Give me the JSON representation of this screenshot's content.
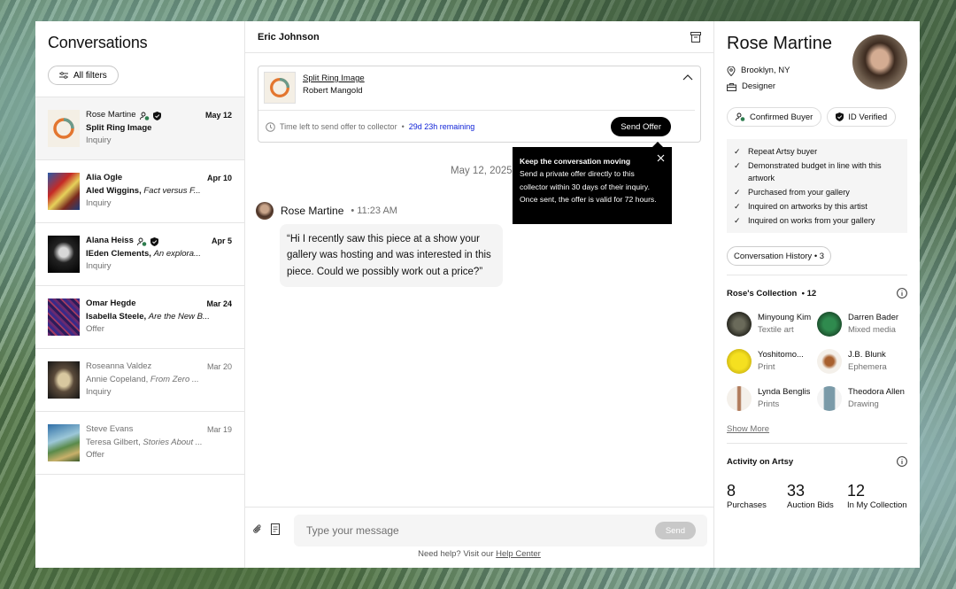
{
  "conversations_panel": {
    "title": "Conversations",
    "filter_label": "All filters",
    "items": [
      {
        "name": "Rose Martine",
        "line2_title": "Split Ring Image",
        "line2_artist": "",
        "type": "Inquiry",
        "date": "May 12"
      },
      {
        "name": "Alia Ogle",
        "line2_artist": "Aled Wiggins,",
        "line2_title": "Fact versus F...",
        "type": "Inquiry",
        "date": "Apr 10"
      },
      {
        "name": "Alana Heiss",
        "line2_artist": "IEden Clements,",
        "line2_title": "An explora...",
        "type": "Inquiry",
        "date": "Apr 5"
      },
      {
        "name": "Omar Hegde",
        "line2_artist": "Isabella Steele,",
        "line2_title": "Are the New B...",
        "type": "Offer",
        "date": "Mar 24"
      },
      {
        "name": "Roseanna Valdez",
        "line2_artist": "Annie Copeland,",
        "line2_title": "From Zero ...",
        "type": "Inquiry",
        "date": "Mar 20"
      },
      {
        "name": "Steve Evans",
        "line2_artist": "Teresa Gilbert,",
        "line2_title": "Stories About ...",
        "type": "Offer",
        "date": "Mar 19"
      }
    ]
  },
  "chat": {
    "header_title": "Eric Johnson",
    "artwork": {
      "title": "Split Ring Image",
      "artist": "Robert Mangold"
    },
    "time_left_label": "Time left to send offer to collector",
    "separator": "•",
    "time_remaining": "29d 23h remaining",
    "send_offer_label": "Send Offer",
    "tooltip": {
      "heading": "Keep the conversation moving",
      "body": "Send a private offer directly to this collector within 30 days of their inquiry. Once sent, the offer is valid for 72 hours."
    },
    "date_separator": "May 12, 2025",
    "message": {
      "sender": "Rose Martine",
      "time": "• 11:23 AM",
      "text": "“Hi I recently saw this piece at a show your gallery was hosting and was interested in this piece. Could we possibly work out a price?”"
    },
    "composer": {
      "placeholder": "Type your message",
      "send_label": "Send",
      "help_prefix": "Need help? Visit our",
      "help_link": "Help Center"
    }
  },
  "profile": {
    "name": "Rose Martine",
    "location": "Brooklyn, NY",
    "profession": "Designer",
    "badges": [
      "Confirmed Buyer",
      "ID Verified"
    ],
    "signals": [
      "Repeat Artsy buyer",
      "Demonstrated budget in line with this artwork",
      "Purchased from your gallery",
      "Inquired on artworks by this artist",
      "Inquired on works from your gallery"
    ],
    "history_label": "Conversation History",
    "history_count": "• 3",
    "collection_title": "Rose's Collection",
    "collection_count": "• 12",
    "collection": [
      {
        "name": "Minyoung Kim",
        "medium": "Textile art"
      },
      {
        "name": "Darren Bader",
        "medium": "Mixed media"
      },
      {
        "name": "Yoshitomo...",
        "medium": "Print"
      },
      {
        "name": "J.B. Blunk",
        "medium": "Ephemera"
      },
      {
        "name": "Lynda Benglis",
        "medium": "Prints"
      },
      {
        "name": "Theodora Allen",
        "medium": "Drawing"
      }
    ],
    "show_more": "Show More",
    "activity_title": "Activity on Artsy",
    "stats": [
      {
        "value": "8",
        "label": "Purchases"
      },
      {
        "value": "33",
        "label": "Auction Bids"
      },
      {
        "value": "12",
        "label": "In My Collection"
      }
    ]
  }
}
